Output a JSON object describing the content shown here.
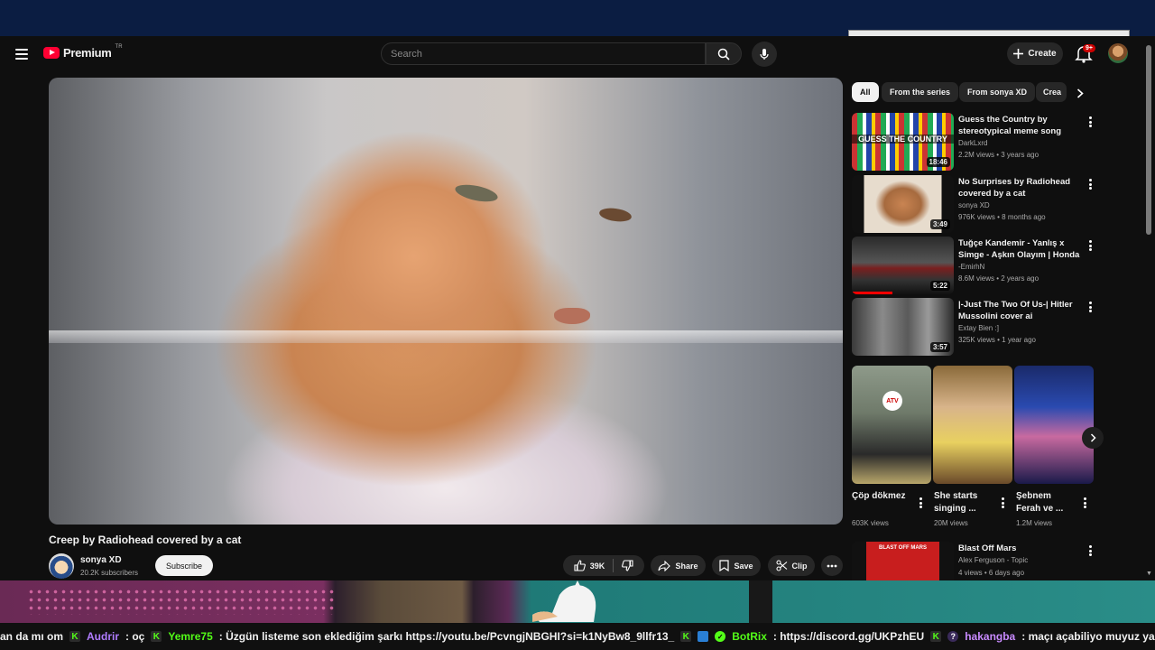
{
  "header": {
    "logo_text": "Premium",
    "logo_region": "TR",
    "search_placeholder": "Search",
    "create_label": "Create",
    "notification_count": "9+"
  },
  "video": {
    "title": "Creep by Radiohead covered by a cat",
    "channel": "sonya XD",
    "subscribers": "20.2K subscribers",
    "subscribe_label": "Subscribe",
    "likes": "39K",
    "share_label": "Share",
    "save_label": "Save",
    "clip_label": "Clip"
  },
  "chips": [
    "All",
    "From the series",
    "From sonya XD",
    "Crea"
  ],
  "recommendations": [
    {
      "title": "Guess the Country by stereotypical meme song",
      "channel": "DarkLxrd",
      "meta": "2.2M views • 3 years ago",
      "duration": "18:46",
      "thumb_text": "GUESS THE COUNTRY"
    },
    {
      "title": "No Surprises by Radiohead covered by a cat",
      "channel": "sonya XD",
      "meta": "976K views • 8 months ago",
      "duration": "3:49"
    },
    {
      "title": "Tuğçe Kandemir - Yanlış x Simge - Aşkın Olayım | Honda ...",
      "channel": "-EmirhN",
      "meta": "8.6M views • 2 years ago",
      "duration": "5:22"
    },
    {
      "title": "|-Just The Two Of Us-| Hitler Mussolini cover ai",
      "channel": "Extay Bien :]",
      "meta": "325K views • 1 year ago",
      "duration": "3:57"
    }
  ],
  "shorts": [
    {
      "title": "Çöp dökmez",
      "views": "603K views",
      "thumb_text": "ATV"
    },
    {
      "title": "She starts singing ...",
      "views": "20M views"
    },
    {
      "title": "Şebnem Ferah ve ...",
      "views": "1.2M views"
    }
  ],
  "last_rec": {
    "title": "Blast Off Mars",
    "channel": "Alex Ferguson - Topic",
    "meta": "4 views • 6 days ago",
    "thumb_text": "BLAST OFF MARS"
  },
  "chat": {
    "lead": "an da mı om",
    "msg1_user": "Audrir",
    "msg1_text": ": oç",
    "msg2_user": "Yemre75",
    "msg2_text": ": Üzgün listeme son eklediğim şarkı https://youtu.be/PcvngjNBGHI?si=k1NyBw8_9llfr13_",
    "msg3_user": "BotRix",
    "msg3_text": ": https://discord.gg/UKPzhEU",
    "msg4_user": "hakangba",
    "msg4_text": ": maçı açabiliyo muyuz ya"
  },
  "colors": {
    "youtube_red": "#ff0033",
    "kick_green": "#53fc18",
    "background": "#0f0f0f"
  }
}
